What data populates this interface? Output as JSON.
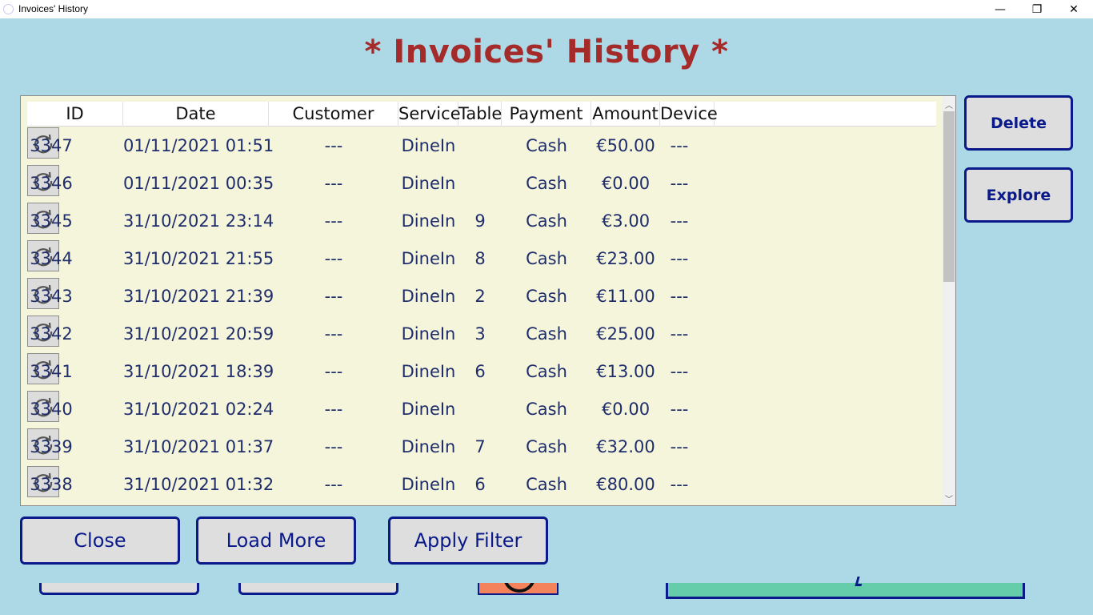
{
  "window": {
    "title": "Invoices' History",
    "min_glyph": "—",
    "max_glyph": "❐",
    "close_glyph": "✕"
  },
  "heading": "* Invoices' History *",
  "columns": {
    "id": "ID",
    "date": "Date",
    "customer": "Customer",
    "service": "Service",
    "table": "Table",
    "payment": "Payment",
    "amount": "Amount",
    "device": "Device"
  },
  "rows": [
    {
      "id": "3347",
      "date": "01/11/2021 01:51",
      "customer": "---",
      "service": "DineIn",
      "table": "",
      "payment": "Cash",
      "amount": "€50.00",
      "device": "---"
    },
    {
      "id": "3346",
      "date": "01/11/2021 00:35",
      "customer": "---",
      "service": "DineIn",
      "table": "",
      "payment": "Cash",
      "amount": "€0.00",
      "device": "---"
    },
    {
      "id": "3345",
      "date": "31/10/2021 23:14",
      "customer": "---",
      "service": "DineIn",
      "table": "9",
      "payment": "Cash",
      "amount": "€3.00",
      "device": "---"
    },
    {
      "id": "3344",
      "date": "31/10/2021 21:55",
      "customer": "---",
      "service": "DineIn",
      "table": "8",
      "payment": "Cash",
      "amount": "€23.00",
      "device": "---"
    },
    {
      "id": "3343",
      "date": "31/10/2021 21:39",
      "customer": "---",
      "service": "DineIn",
      "table": "2",
      "payment": "Cash",
      "amount": "€11.00",
      "device": "---"
    },
    {
      "id": "3342",
      "date": "31/10/2021 20:59",
      "customer": "---",
      "service": "DineIn",
      "table": "3",
      "payment": "Cash",
      "amount": "€25.00",
      "device": "---"
    },
    {
      "id": "3341",
      "date": "31/10/2021 18:39",
      "customer": "---",
      "service": "DineIn",
      "table": "6",
      "payment": "Cash",
      "amount": "€13.00",
      "device": "---"
    },
    {
      "id": "3340",
      "date": "31/10/2021 02:24",
      "customer": "---",
      "service": "DineIn",
      "table": "",
      "payment": "Cash",
      "amount": "€0.00",
      "device": "---"
    },
    {
      "id": "3339",
      "date": "31/10/2021 01:37",
      "customer": "---",
      "service": "DineIn",
      "table": "7",
      "payment": "Cash",
      "amount": "€32.00",
      "device": "---"
    },
    {
      "id": "3338",
      "date": "31/10/2021 01:32",
      "customer": "---",
      "service": "DineIn",
      "table": "6",
      "payment": "Cash",
      "amount": "€80.00",
      "device": "---"
    }
  ],
  "row_action_icon": "reload-icon",
  "side_buttons": {
    "delete": "Delete",
    "explore": "Explore"
  },
  "bottom_buttons": {
    "close": "Close",
    "load_more": "Load More",
    "apply_filter": "Apply Filter"
  },
  "colors": {
    "background": "#add8e6",
    "heading": "#a52a2a",
    "grid_background": "#f5f5dc",
    "button_border": "#0a1a8a",
    "cell_text": "#1f2d6b"
  }
}
